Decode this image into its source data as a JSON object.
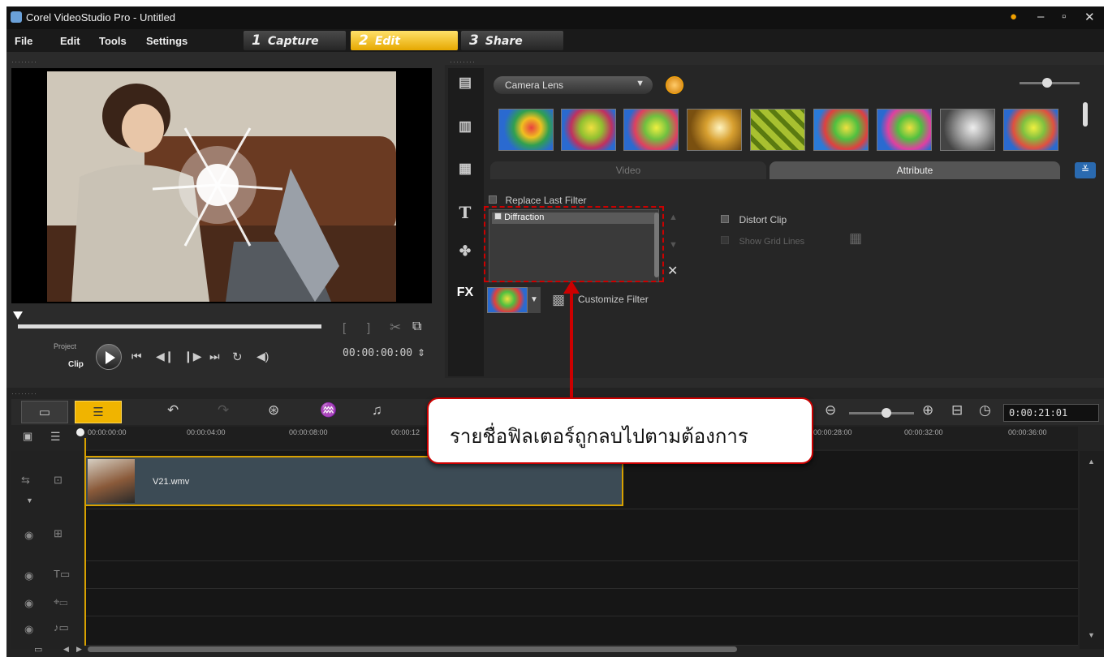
{
  "window": {
    "title": "Corel VideoStudio Pro - Untitled"
  },
  "menu": {
    "items": [
      "File",
      "Edit",
      "Tools",
      "Settings"
    ]
  },
  "steps": [
    {
      "num": "1",
      "label": "Capture"
    },
    {
      "num": "2",
      "label": "Edit"
    },
    {
      "num": "3",
      "label": "Share"
    }
  ],
  "player": {
    "mode_project": "Project",
    "mode_clip": "Clip",
    "timecode": "00:00:00:00"
  },
  "library": {
    "category": "Camera Lens",
    "tabs": {
      "video": "Video",
      "attribute": "Attribute"
    },
    "replace_last_filter": "Replace Last Filter",
    "filter_item": "Diffraction",
    "distort_clip": "Distort Clip",
    "show_grid_lines": "Show Grid Lines",
    "customize_filter": "Customize Filter",
    "fx_label": "FX"
  },
  "timeline": {
    "timecode": "0:00:21:01",
    "ruler": [
      "00:00:00:00",
      "00:00:04:00",
      "00:00:08:00",
      "00:00:12",
      "00:00:28:00",
      "00:00:32:00",
      "00:00:36:00"
    ],
    "clip_name": "V21.wmv"
  },
  "callout": {
    "text": "รายชื่อฟิลเตอร์ถูกลบไปตามต้องการ"
  },
  "colors": {
    "accent": "#f0b400",
    "callout_border": "#cc0000"
  }
}
